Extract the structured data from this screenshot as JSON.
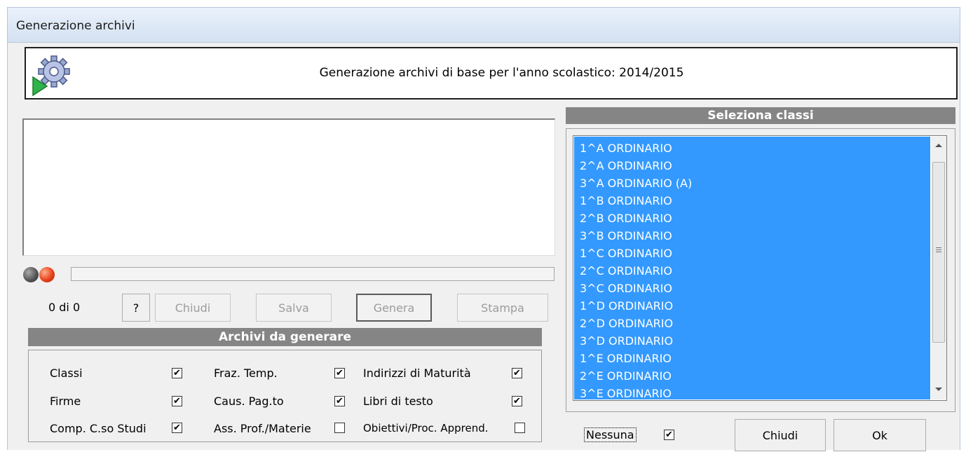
{
  "window": {
    "title": "Generazione archivi"
  },
  "header": {
    "icon": "gear-play-icon",
    "text": "Generazione archivi di base per l'anno scolastico: 2014/2015"
  },
  "progress": {
    "counter": "0 di 0",
    "value": 0
  },
  "buttons": {
    "help": "?",
    "chiudi": "Chiudi",
    "salva": "Salva",
    "genera": "Genera",
    "stampa": "Stampa"
  },
  "archivi": {
    "title": "Archivi da generare",
    "items": [
      {
        "label": "Classi",
        "checked": true
      },
      {
        "label": "Firme",
        "checked": true
      },
      {
        "label": "Comp. C.so Studi",
        "checked": true
      },
      {
        "label": "Fraz. Temp.",
        "checked": true
      },
      {
        "label": "Caus. Pag.to",
        "checked": true
      },
      {
        "label": "Ass. Prof./Materie",
        "checked": false
      },
      {
        "label": "Indirizzi di Maturità",
        "checked": true
      },
      {
        "label": "Libri di testo",
        "checked": true
      },
      {
        "label": "Obiettivi/Proc. Apprend.",
        "checked": false
      }
    ]
  },
  "classi": {
    "title": "Seleziona classi",
    "items": [
      "1^A ORDINARIO",
      "2^A ORDINARIO",
      "3^A ORDINARIO (A)",
      "1^B ORDINARIO",
      "2^B ORDINARIO",
      "3^B ORDINARIO",
      "1^C ORDINARIO",
      "2^C ORDINARIO",
      "3^C ORDINARIO",
      "1^D ORDINARIO",
      "2^D ORDINARIO",
      "3^D ORDINARIO",
      "1^E ORDINARIO",
      "2^E ORDINARIO",
      "3^E ORDINARIO"
    ],
    "nessuna_label": "Nessuna",
    "nessuna_checked": true,
    "chiudi": "Chiudi",
    "ok": "Ok"
  },
  "colors": {
    "selection": "#3399ff",
    "section_header": "#858585",
    "led_red": "#e8411a",
    "led_gray": "#505050"
  }
}
